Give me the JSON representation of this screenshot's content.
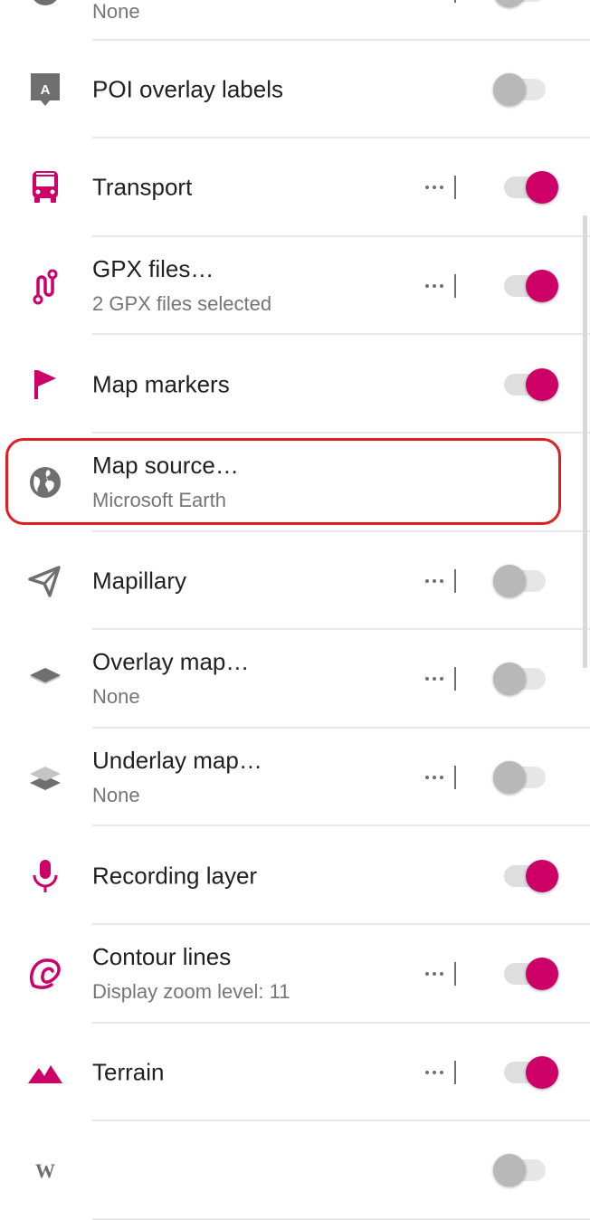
{
  "colors": {
    "accent": "#cc0066",
    "icon_gray": "#6f6f6f",
    "highlight": "#e02020"
  },
  "rows": [
    {
      "icon": "layers-icon",
      "title": "",
      "subtitle": "None",
      "has_more": true,
      "toggle": "off"
    },
    {
      "icon": "poi-label-icon",
      "title": "POI overlay labels",
      "subtitle": "",
      "has_more": false,
      "toggle": "off"
    },
    {
      "icon": "bus-icon",
      "title": "Transport",
      "subtitle": "",
      "has_more": true,
      "toggle": "on"
    },
    {
      "icon": "gpx-route-icon",
      "title": "GPX files…",
      "subtitle": "2 GPX files selected",
      "has_more": true,
      "toggle": "on"
    },
    {
      "icon": "flag-icon",
      "title": "Map markers",
      "subtitle": "",
      "has_more": false,
      "toggle": "on"
    },
    {
      "icon": "globe-icon",
      "title": "Map source…",
      "subtitle": "Microsoft Earth",
      "has_more": false,
      "toggle": "none"
    },
    {
      "icon": "mapillary-icon",
      "title": "Mapillary",
      "subtitle": "",
      "has_more": true,
      "toggle": "off"
    },
    {
      "icon": "overlay-map-icon",
      "title": "Overlay map…",
      "subtitle": "None",
      "has_more": true,
      "toggle": "off"
    },
    {
      "icon": "underlay-map-icon",
      "title": "Underlay map…",
      "subtitle": "None",
      "has_more": true,
      "toggle": "off"
    },
    {
      "icon": "microphone-icon",
      "title": "Recording layer",
      "subtitle": "",
      "has_more": false,
      "toggle": "on"
    },
    {
      "icon": "contour-lines-icon",
      "title": "Contour lines",
      "subtitle": "Display zoom level: 11",
      "has_more": true,
      "toggle": "on"
    },
    {
      "icon": "terrain-icon",
      "title": "Terrain",
      "subtitle": "",
      "has_more": true,
      "toggle": "on"
    },
    {
      "icon": "wikipedia-icon",
      "title": "",
      "subtitle": "",
      "has_more": false,
      "toggle": "off"
    }
  ]
}
